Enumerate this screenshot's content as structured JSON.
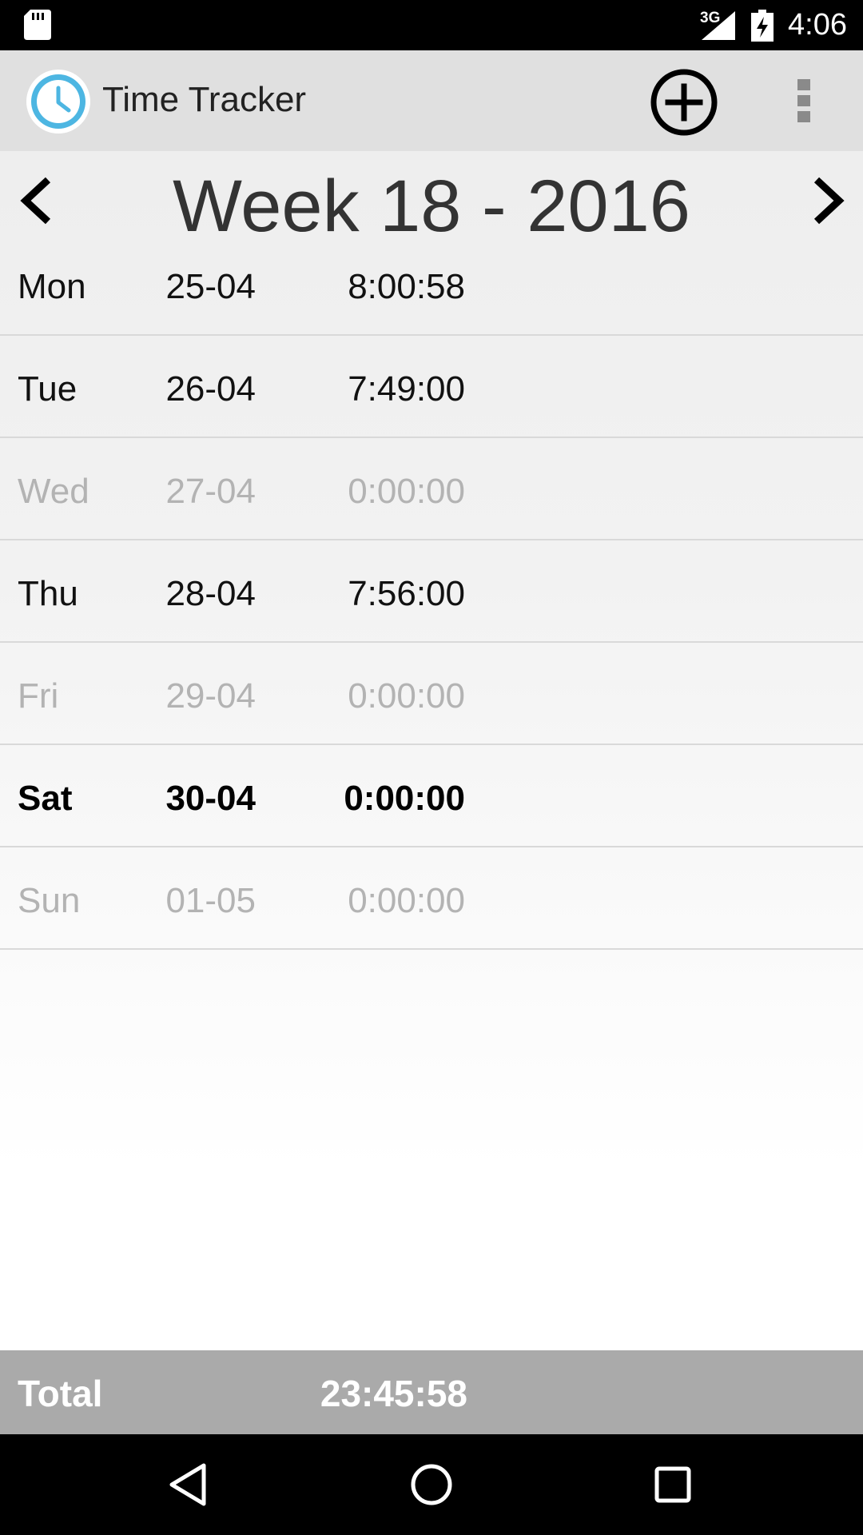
{
  "status_bar": {
    "network": "3G",
    "time": "4:06"
  },
  "app_bar": {
    "title": "Time Tracker",
    "icons": {
      "logo": "clock-logo",
      "add": "add-circle-icon",
      "overflow": "more-vert-icon"
    }
  },
  "week": {
    "title": "Week 18 - 2016",
    "prev_icon": "chevron-left-icon",
    "next_icon": "chevron-right-icon"
  },
  "days": [
    {
      "day": "Mon",
      "date": "25-04",
      "time": "8:00:58",
      "state": "normal"
    },
    {
      "day": "Tue",
      "date": "26-04",
      "time": "7:49:00",
      "state": "normal"
    },
    {
      "day": "Wed",
      "date": "27-04",
      "time": "0:00:00",
      "state": "dim"
    },
    {
      "day": "Thu",
      "date": "28-04",
      "time": "7:56:00",
      "state": "normal"
    },
    {
      "day": "Fri",
      "date": "29-04",
      "time": "0:00:00",
      "state": "dim"
    },
    {
      "day": "Sat",
      "date": "30-04",
      "time": "0:00:00",
      "state": "today"
    },
    {
      "day": "Sun",
      "date": "01-05",
      "time": "0:00:00",
      "state": "dim"
    }
  ],
  "total": {
    "label": "Total",
    "value": "23:45:58"
  },
  "colors": {
    "accent": "#4db6e2",
    "action_bar": "#e0e0e0",
    "total_bar": "#aaaaaa",
    "dim_text": "#b3b3b3"
  }
}
